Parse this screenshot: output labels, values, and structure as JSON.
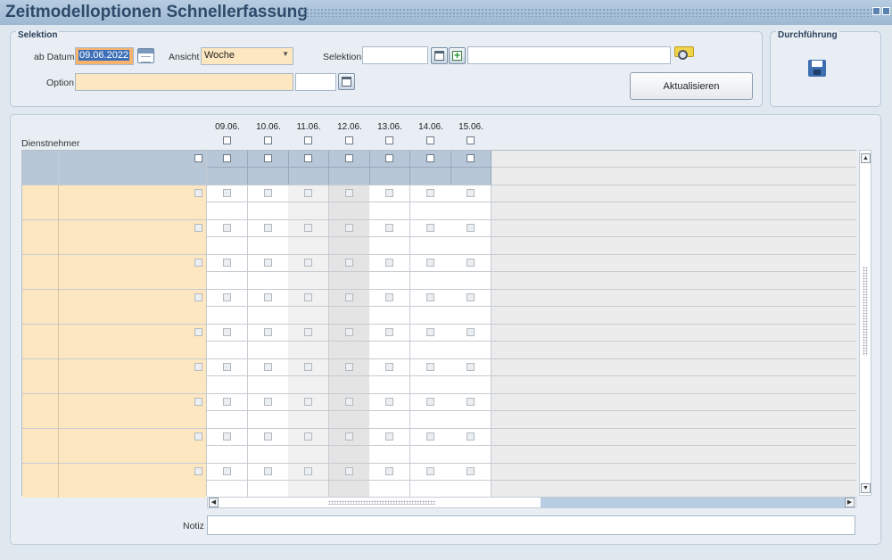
{
  "title": "Zeitmodelloptionen Schnellerfassung",
  "selektion_group": {
    "legend": "Selektion"
  },
  "ab_datum": {
    "label": "ab Datum",
    "value": "09.06.2022"
  },
  "ansicht": {
    "label": "Ansicht",
    "value": "Woche"
  },
  "selektion": {
    "label": "Selektion",
    "value1": "",
    "value2": ""
  },
  "option": {
    "label": "Option",
    "value1": "",
    "value2": ""
  },
  "aktualisieren_label": "Aktualisieren",
  "durchfuehrung_group": {
    "legend": "Durchführung"
  },
  "grid": {
    "row_header": "Dienstnehmer",
    "dates": [
      "09.06.",
      "10.06.",
      "11.06.",
      "12.06.",
      "13.06.",
      "14.06.",
      "15.06."
    ],
    "row_count": 9,
    "weekend_columns": [
      2,
      3
    ]
  },
  "notiz": {
    "label": "Notiz",
    "value": ""
  },
  "colors": {
    "accent": "#3d6fb8",
    "peach": "#fde7c0",
    "header_blue": "#b8c7d8"
  }
}
